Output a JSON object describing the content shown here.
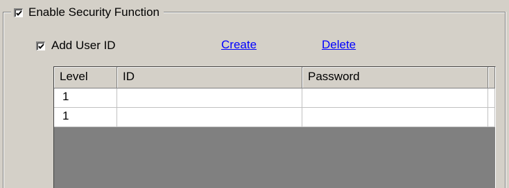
{
  "group": {
    "title": "Enable Security Function",
    "checked": true
  },
  "add_user": {
    "label": "Add User ID",
    "checked": true
  },
  "links": {
    "create": "Create",
    "delete": "Delete"
  },
  "table": {
    "columns": [
      "Level",
      "ID",
      "Password"
    ],
    "rows": [
      {
        "level": "1",
        "id": "",
        "password": ""
      },
      {
        "level": "1",
        "id": "",
        "password": ""
      }
    ]
  }
}
